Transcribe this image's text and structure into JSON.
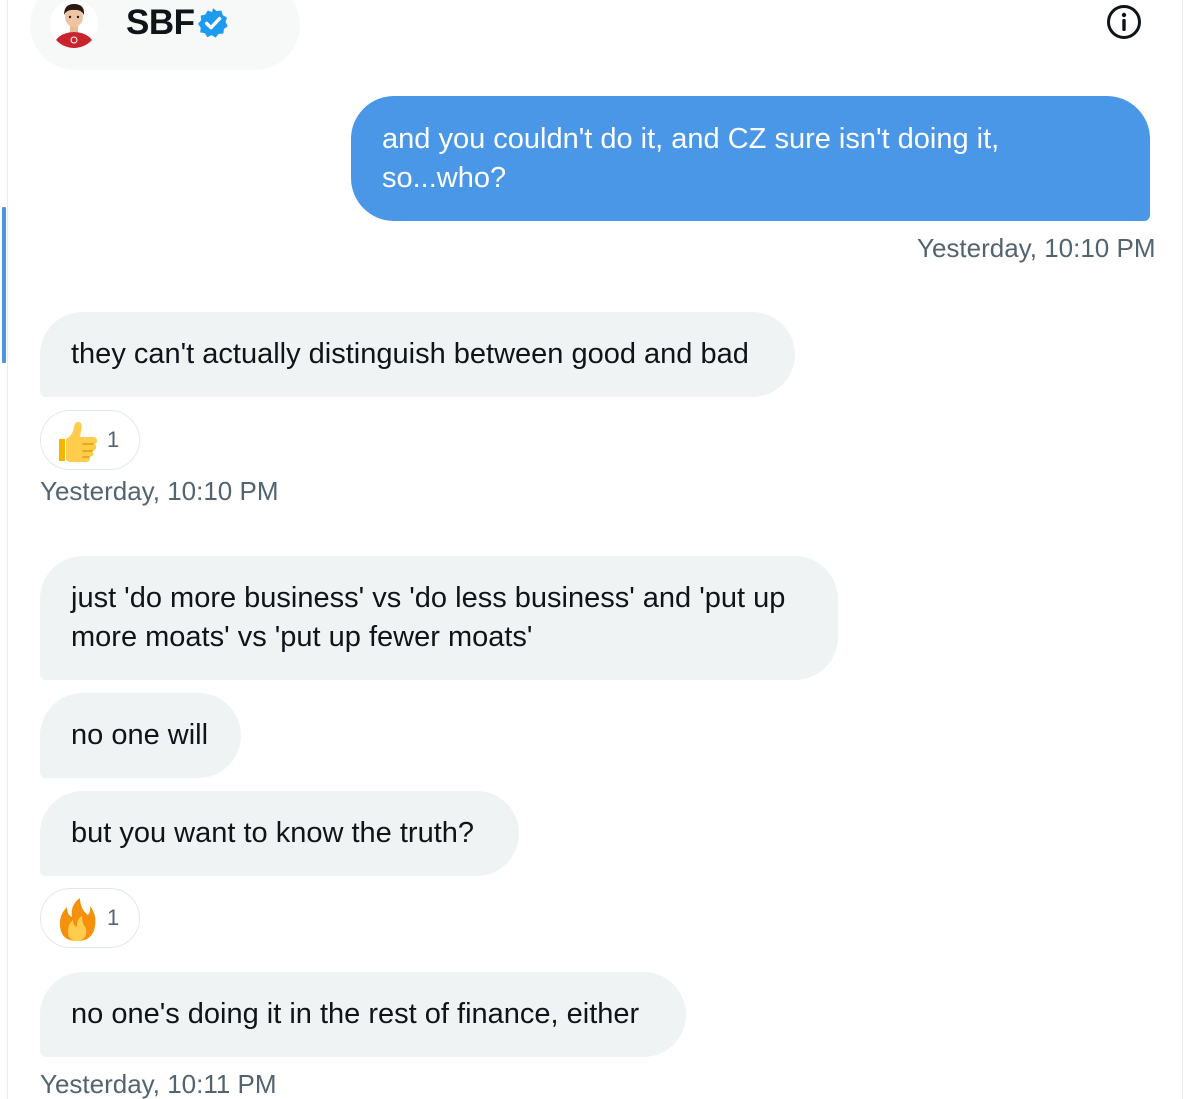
{
  "header": {
    "name": "SBF",
    "avatar_icon": "profile-avatar",
    "verified_icon": "verified-badge-icon",
    "info_icon": "info-icon"
  },
  "colors": {
    "outgoing_bubble": "#4a97e8",
    "incoming_bubble": "#eff3f4",
    "timestamp": "#536471",
    "verified": "#1d9bf0"
  },
  "messages": [
    {
      "direction": "outgoing",
      "text": "and you couldn't do it, and CZ sure isn't doing it,\nso...who?",
      "timestamp": "Yesterday, 10:10 PM"
    },
    {
      "direction": "incoming",
      "text": "they can't actually distinguish between good and bad",
      "reaction": {
        "emoji": "thumbs-up-icon",
        "count": "1"
      },
      "timestamp": "Yesterday, 10:10 PM"
    },
    {
      "direction": "incoming",
      "text": "just 'do more business' vs 'do less business' and 'put up\nmore moats' vs 'put up fewer moats'"
    },
    {
      "direction": "incoming",
      "text": "no one will"
    },
    {
      "direction": "incoming",
      "text": "but you want to know the truth?",
      "reaction": {
        "emoji": "fire-icon",
        "count": "1"
      }
    },
    {
      "direction": "incoming",
      "text": "no one's doing it in the rest of finance, either",
      "timestamp": "Yesterday, 10:11 PM"
    }
  ]
}
